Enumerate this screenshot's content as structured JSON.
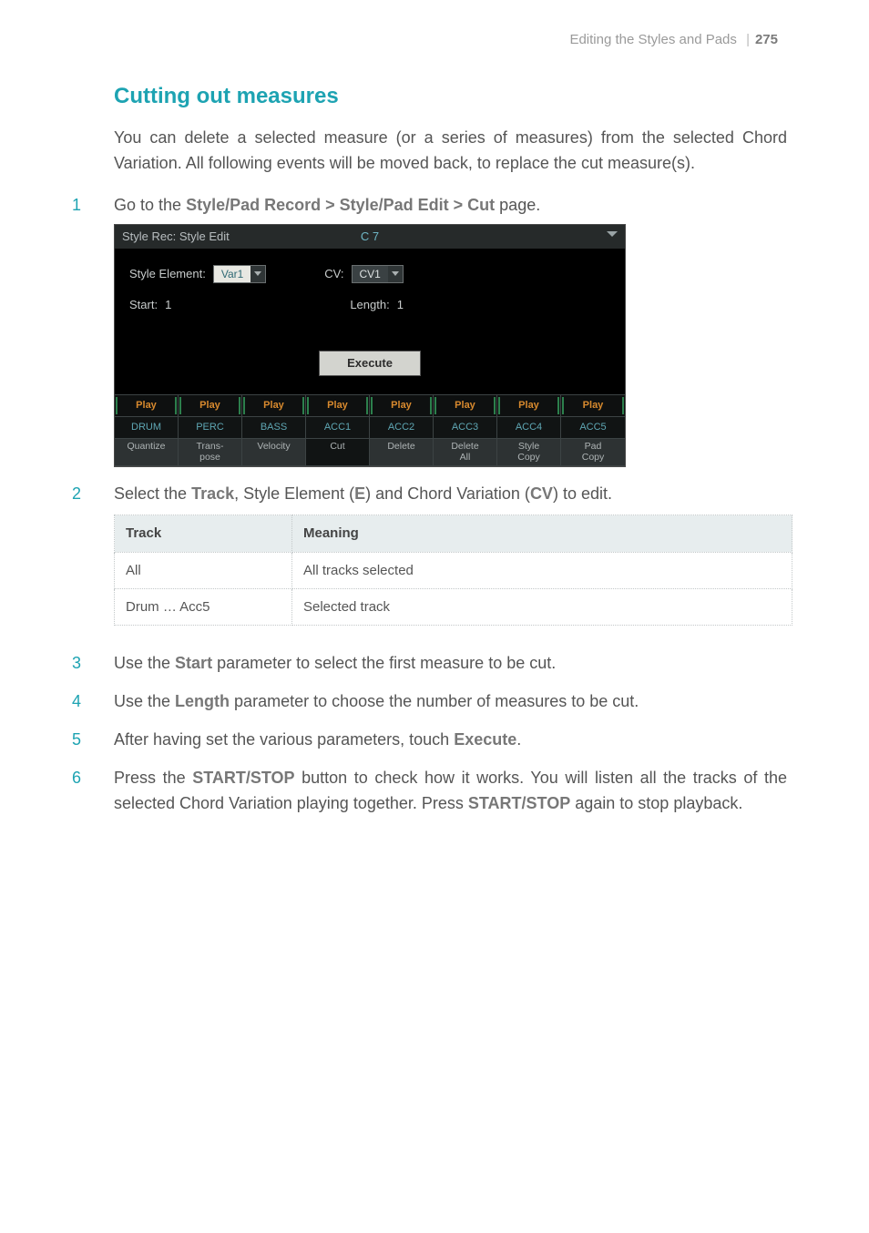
{
  "header": {
    "title": "Editing the Styles and Pads",
    "separator": "|",
    "page": "275"
  },
  "section": {
    "title": "Cutting out measures"
  },
  "intro": "You can delete a selected measure (or a series of measures) from the selected Chord Variation. All following events will be moved back, to replace the cut measure(s).",
  "steps": {
    "s1_pre": "Go to the ",
    "s1_kw": "Style/Pad Record > Style/Pad Edit > Cut",
    "s1_post": " page.",
    "s2_a": "Select the ",
    "s2_kw1": "Track",
    "s2_b": ", Style Element (",
    "s2_kw2": "E",
    "s2_c": ") and Chord Variation (",
    "s2_kw3": "CV",
    "s2_d": ") to edit.",
    "s3_a": "Use the ",
    "s3_kw": "Start",
    "s3_b": " parameter to select the first measure to be cut.",
    "s4_a": "Use the ",
    "s4_kw": "Length",
    "s4_b": " parameter to choose the number of measures to be cut.",
    "s5_a": "After having set the various parameters, touch ",
    "s5_kw": "Execute",
    "s5_b": ".",
    "s6_a": "Press the ",
    "s6_kw1": "START/STOP",
    "s6_b": " button to check how it works. You will listen all the tracks of the selected Chord Variation playing together. Press ",
    "s6_kw2": "START/STOP",
    "s6_c": " again to stop playback."
  },
  "shot": {
    "title_left": "Style Rec: Style Edit",
    "title_center": "C 7",
    "row1": {
      "label": "Style Element:",
      "val": "Var1",
      "cv_label": "CV:",
      "cv_val": "CV1"
    },
    "row2": {
      "start_label": "Start:",
      "start_val": "1",
      "len_label": "Length:",
      "len_val": "1"
    },
    "execute": "Execute",
    "playRow": [
      "Play",
      "Play",
      "Play",
      "Play",
      "Play",
      "Play",
      "Play",
      "Play"
    ],
    "nameRow": [
      "DRUM",
      "PERC",
      "BASS",
      "ACC1",
      "ACC2",
      "ACC3",
      "ACC4",
      "ACC5"
    ],
    "tabRow": [
      "Quantize",
      "Trans-\npose",
      "Velocity",
      "Cut",
      "Delete",
      "Delete\nAll",
      "Style\nCopy",
      "Pad\nCopy"
    ],
    "activeTab": 3
  },
  "table": {
    "head": {
      "c1": "Track",
      "c2": "Meaning"
    },
    "rows": [
      {
        "c1": "All",
        "c2": "All tracks selected"
      },
      {
        "c1": "Drum … Acc5",
        "c2": "Selected track"
      }
    ]
  }
}
